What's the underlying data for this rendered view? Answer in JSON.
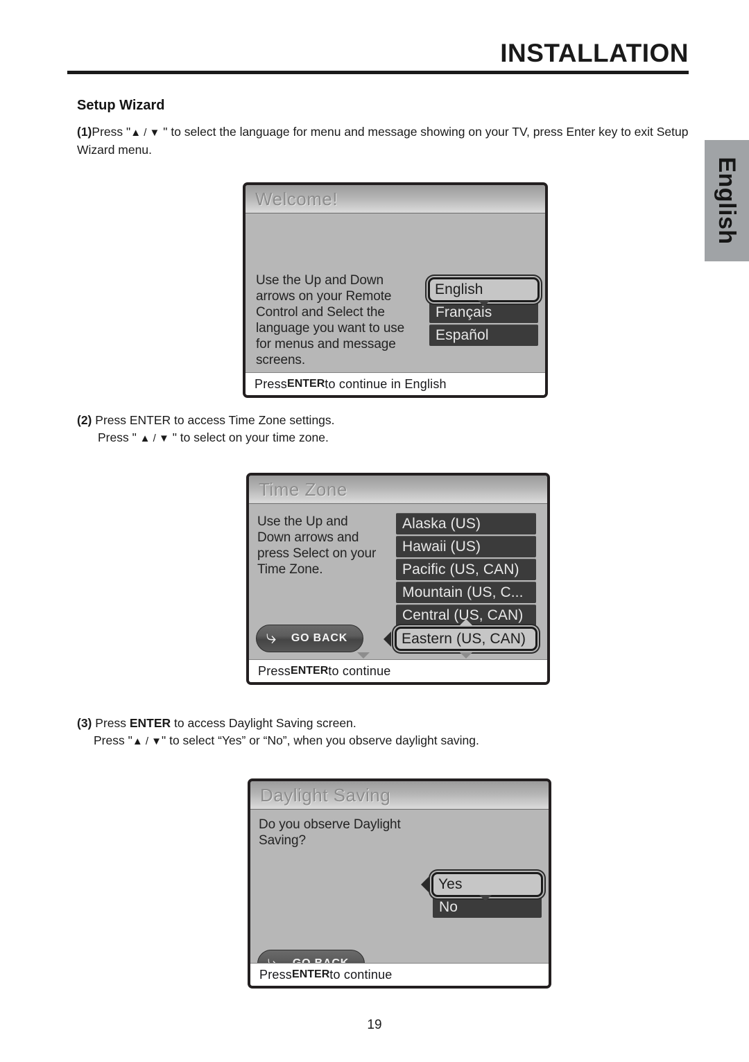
{
  "header": {
    "title": "INSTALLATION"
  },
  "side_tab": {
    "label": "English"
  },
  "section": {
    "title": "Setup Wizard"
  },
  "steps": {
    "step1": {
      "number": "(1)",
      "text_before": "Press \"",
      "arrows": "▲ / ▼",
      "text_after": " \" to select the language for menu and message showing on your TV, press Enter key to exit Setup Wizard menu."
    },
    "step2": {
      "number": "(2)",
      "line1": "Press ENTER to access Time Zone settings.",
      "line2_before": "Press \" ",
      "line2_arrows": "▲ / ▼",
      "line2_after": " \" to select on your time zone."
    },
    "step3": {
      "number": "(3)",
      "line1_before": "Press ",
      "line1_bold": "ENTER",
      "line1_after": " to access Daylight Saving screen.",
      "line2_before": "Press \"",
      "line2_arrows": "▲ / ▼",
      "line2_after": "\" to select “Yes” or “No”, when you observe daylight saving."
    }
  },
  "welcome_screen": {
    "title": "Welcome!",
    "description": "Use the Up and Down arrows on your Remote Control and Select the language you want to use for menus and message screens.",
    "options": [
      {
        "label": "English",
        "selected": true
      },
      {
        "label": "Français",
        "selected": false
      },
      {
        "label": "Español",
        "selected": false
      }
    ],
    "footer_before": "Press ",
    "footer_bold": "ENTER",
    "footer_after": " to continue in English"
  },
  "timezone_screen": {
    "title": "Time Zone",
    "description": "Use the Up and Down arrows and press Select on your Time Zone.",
    "options": [
      {
        "label": "Alaska (US)",
        "selected": false
      },
      {
        "label": "Hawaii (US)",
        "selected": false
      },
      {
        "label": "Pacific (US, CAN)",
        "selected": false
      },
      {
        "label": "Mountain (US, C...",
        "selected": false
      },
      {
        "label": "Central (US, CAN)",
        "selected": false
      },
      {
        "label": "Eastern (US, CAN)",
        "selected": true
      }
    ],
    "go_back": {
      "label": "GO BACK",
      "icon": "back-arrow-icon"
    },
    "footer_before": "Press ",
    "footer_bold": "ENTER",
    "footer_after": " to continue"
  },
  "daylight_screen": {
    "title": "Daylight Saving",
    "description": "Do you observe Daylight Saving?",
    "options": [
      {
        "label": "Yes",
        "selected": true
      },
      {
        "label": "No",
        "selected": false
      }
    ],
    "go_back": {
      "label": "GO BACK",
      "icon": "back-arrow-icon"
    },
    "footer_before": "Press ",
    "footer_bold": "ENTER",
    "footer_after": " to continue"
  },
  "footer": {
    "page_number": "19"
  },
  "colors": {
    "osd_background": "#b7b7b7",
    "osd_border": "#231f20",
    "option_unselected_bg": "#3b3b3b",
    "option_selected_bg": "#c6c6c6",
    "side_tab_bg": "#a0a3a6",
    "text": "#1a1a1a"
  }
}
